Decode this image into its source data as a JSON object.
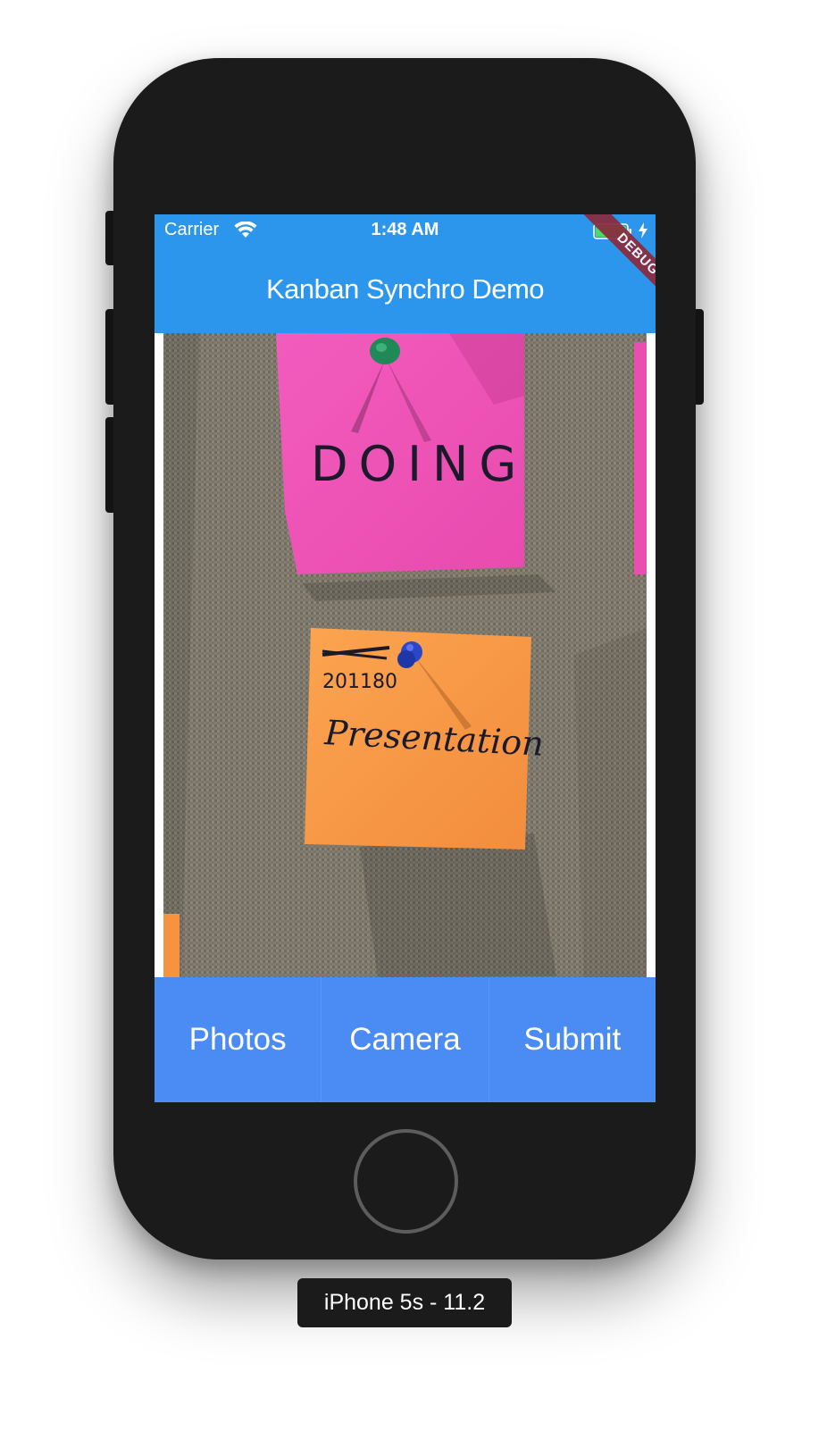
{
  "status_bar": {
    "carrier": "Carrier",
    "time": "1:48 AM",
    "wifi_icon": "wifi-icon",
    "battery_icon": "battery-icon",
    "charging_icon": "bolt-icon"
  },
  "app_bar": {
    "title": "Kanban Synchro Demo",
    "color": "#2c96ec",
    "debug_banner": "DEBUG"
  },
  "photo": {
    "description_notes": [
      {
        "text": "DOING",
        "color": "#ee4fb3"
      },
      {
        "text": "201180",
        "color": "#f99444"
      },
      {
        "text": "Presentation",
        "color": "#f99444"
      }
    ]
  },
  "buttons": {
    "photos_label": "Photos",
    "camera_label": "Camera",
    "submit_label": "Submit",
    "color": "#4b8bf4"
  },
  "device": {
    "label": "iPhone 5s - 11.2"
  }
}
